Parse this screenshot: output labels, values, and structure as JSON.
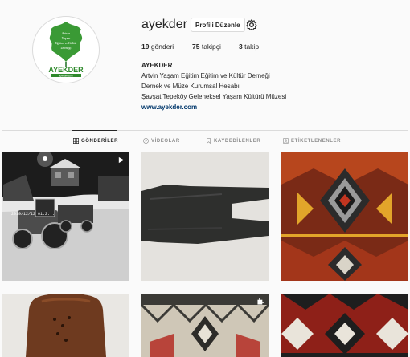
{
  "profile": {
    "username": "ayekder",
    "edit_button_label": "Profili Düzenle",
    "avatar": {
      "logo_lines": [
        "Artvin",
        "Yaşam",
        "Eğitim ve Kültür",
        "Derneği"
      ],
      "logo_name": "AYEKDER",
      "logo_footer": "ayekder.com",
      "colors": {
        "green": "#3a9a35",
        "dark_green": "#1e6e23"
      }
    },
    "stats": {
      "posts_count": "19",
      "posts_label": " gönderi",
      "followers_count": "75",
      "followers_label": " takipçi",
      "following_count": "3",
      "following_label": " takip"
    },
    "bio": {
      "name": "AYEKDER",
      "lines": [
        "Artvin Yaşam Eğitim Eğitim ve Kültür Derneği",
        "Dernek ve Müze Kurumsal Hesabı",
        "Şavşat Tepeköy Geleneksel Yaşam Kültürü Müzesi"
      ],
      "link": "www.ayekder.com"
    }
  },
  "tabs": [
    {
      "label": "GÖNDERİLER",
      "icon": "grid-icon",
      "active": true
    },
    {
      "label": "VİDEOLAR",
      "icon": "video-icon",
      "active": false
    },
    {
      "label": "KAYDEDİLENLER",
      "icon": "bookmark-icon",
      "active": false
    },
    {
      "label": "ETİKETLENENLER",
      "icon": "tag-icon",
      "active": false
    }
  ],
  "posts": [
    {
      "label": "kar-gece-traktor",
      "type": "video",
      "overlay_text": "2019/12/12 01:2..."
    },
    {
      "label": "siyah-ahsap-obje",
      "type": "photo"
    },
    {
      "label": "kilim-desen-1",
      "type": "photo"
    },
    {
      "label": "ahsap-kasik",
      "type": "photo"
    },
    {
      "label": "kilim-desen-2",
      "type": "carousel"
    },
    {
      "label": "kilim-desen-3",
      "type": "photo"
    }
  ],
  "colors": {
    "background": "#fafafa",
    "text": "#262626",
    "muted": "#8e8e8e",
    "link": "#00376b",
    "border": "#dbdbdb"
  }
}
